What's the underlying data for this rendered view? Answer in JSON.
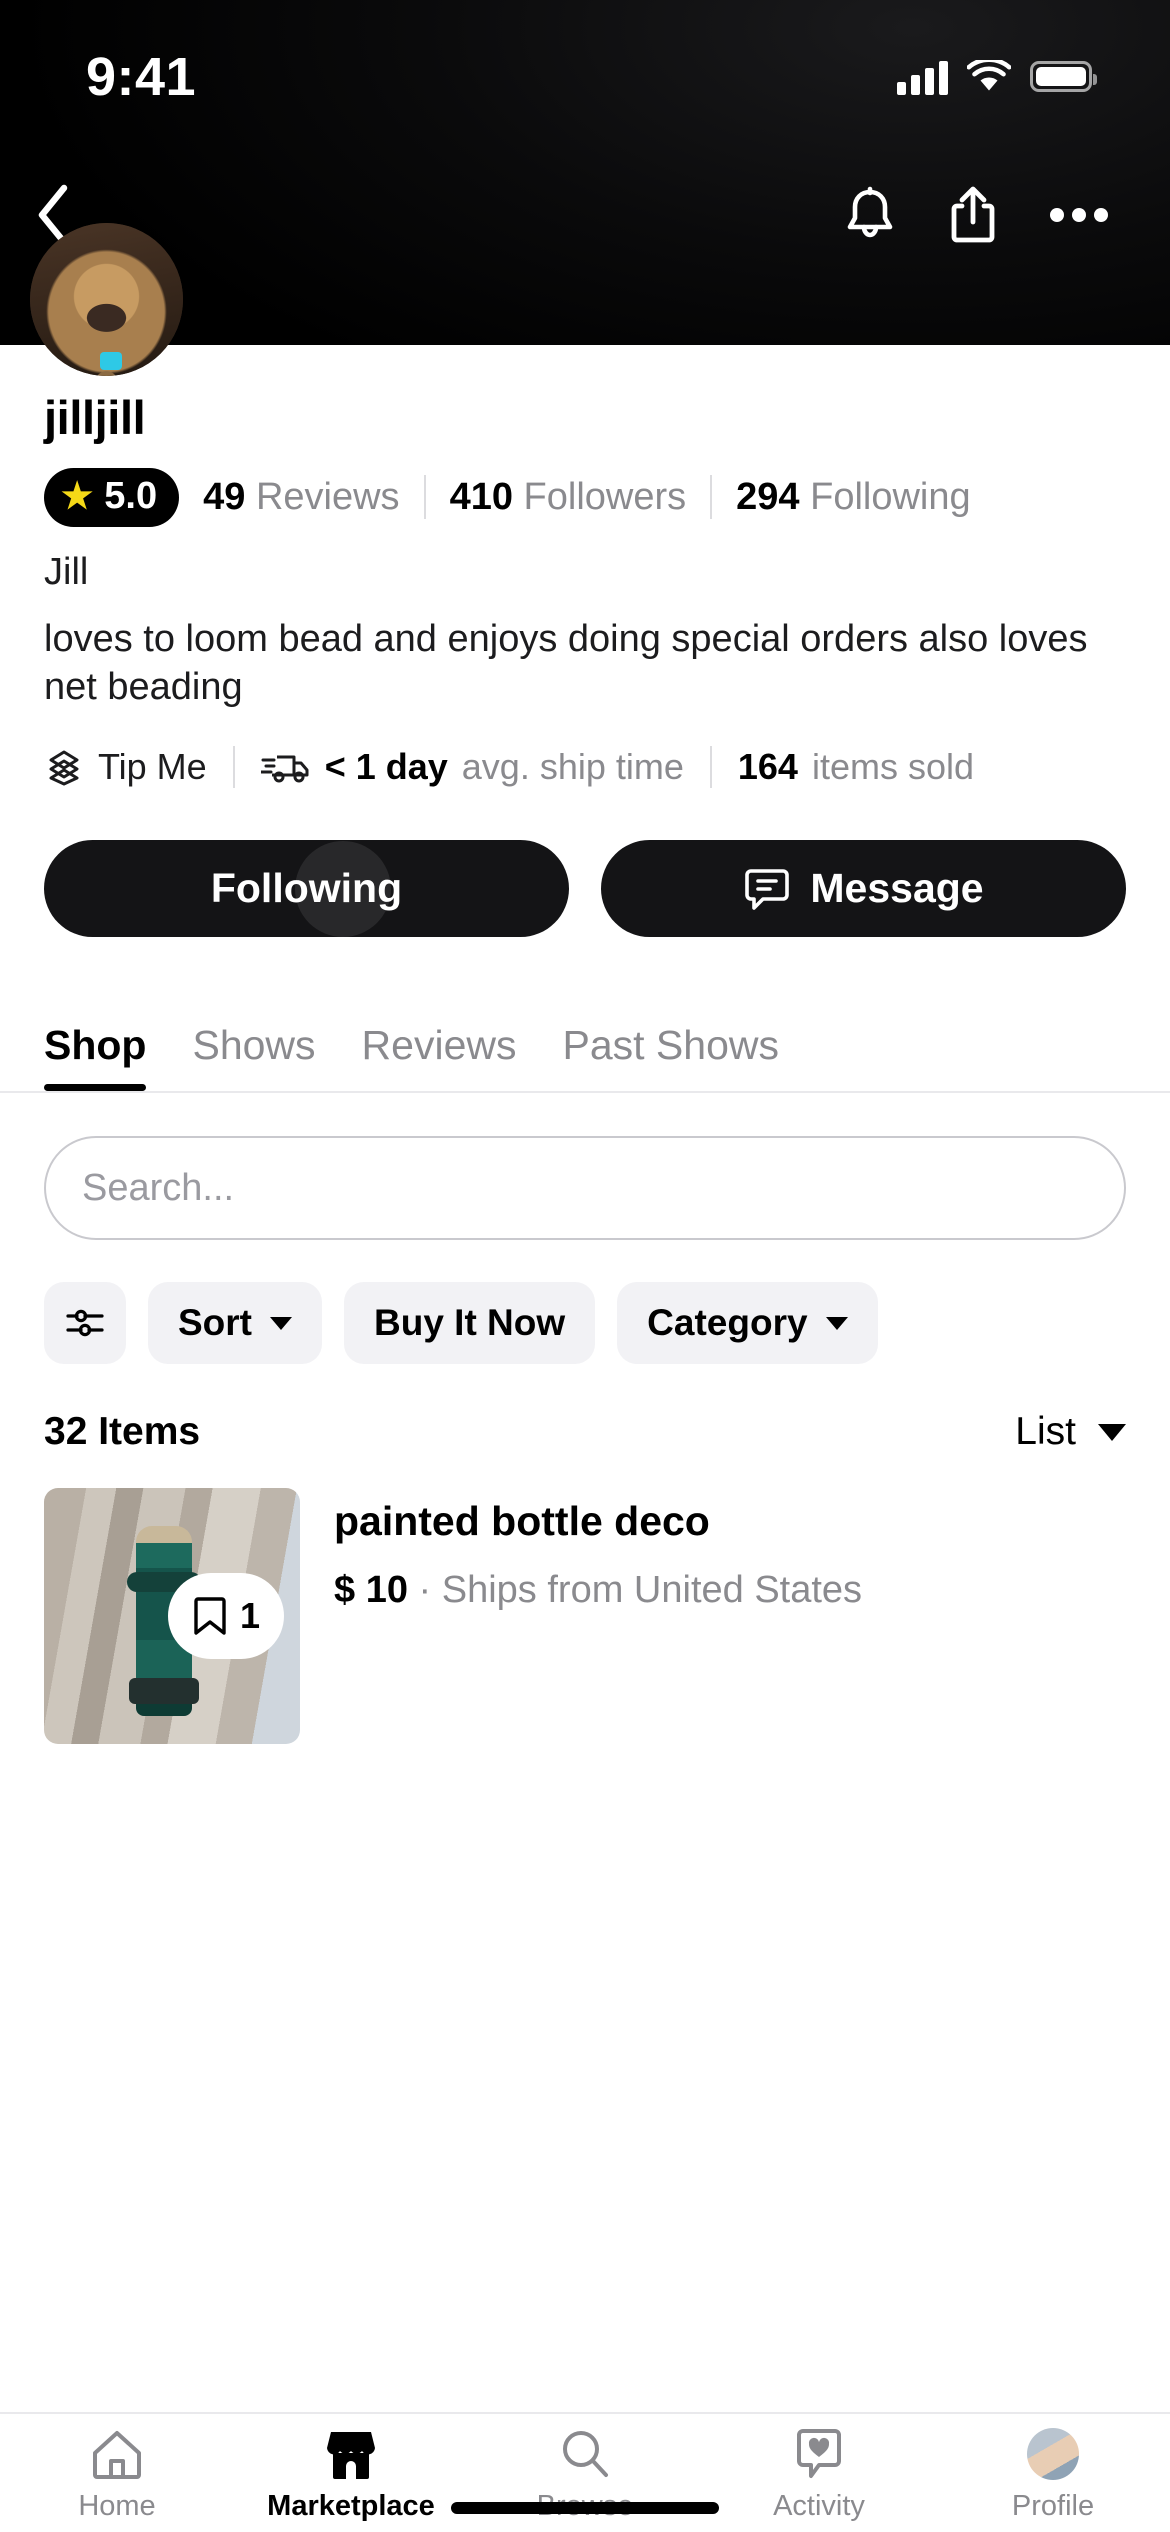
{
  "status_bar": {
    "time": "9:41",
    "signal_icon": "cellular-bars-icon",
    "wifi_icon": "wifi-icon",
    "battery_icon": "battery-full-icon"
  },
  "navbar": {
    "back_icon": "back-chevron-icon",
    "notifications_icon": "bell-icon",
    "share_icon": "share-icon",
    "more_icon": "more-dots-icon"
  },
  "profile": {
    "avatar_icon": "profile-avatar-dog-photo",
    "username": "jilljill",
    "rating": "5.0",
    "rating_star_icon": "star-icon",
    "rating_star_color": "#F5D917",
    "reviews_count": "49",
    "reviews_label": "Reviews",
    "followers_count": "410",
    "followers_label": "Followers",
    "following_count": "294",
    "following_label": "Following",
    "display_name": "Jill",
    "bio": "loves to loom bead and enjoys doing special orders also loves net beading",
    "tip_icon": "tip-cash-icon",
    "tip_label": "Tip Me",
    "ship_icon": "shipping-truck-icon",
    "ship_time": "< 1 day",
    "ship_label": "avg. ship time",
    "items_sold_count": "164",
    "items_sold_label": "items sold",
    "follow_button": "Following",
    "message_button": "Message",
    "message_icon": "chat-bubble-icon"
  },
  "tabs": [
    {
      "label": "Shop",
      "active": true
    },
    {
      "label": "Shows",
      "active": false
    },
    {
      "label": "Reviews",
      "active": false
    },
    {
      "label": "Past Shows",
      "active": false
    }
  ],
  "search": {
    "placeholder": "Search...",
    "value": ""
  },
  "filters": {
    "filter_icon": "sliders-filter-icon",
    "chips": [
      {
        "label": "Sort",
        "has_chevron": true
      },
      {
        "label": "Buy It Now",
        "has_chevron": false
      },
      {
        "label": "Category",
        "has_chevron": true
      }
    ]
  },
  "listing_header": {
    "items_count": "32 Items",
    "view_mode": "List",
    "view_chevron_icon": "chevron-down-icon"
  },
  "products": [
    {
      "title": "painted bottle deco",
      "price": "$ 10",
      "separator": "·",
      "shipping": "Ships from United States",
      "save_icon": "bookmark-icon",
      "save_count": "1",
      "image_icon": "painted-green-bottle-photo"
    }
  ],
  "bottom_nav": [
    {
      "label": "Home",
      "icon": "home-icon",
      "active": false
    },
    {
      "label": "Marketplace",
      "icon": "storefront-icon",
      "active": true
    },
    {
      "label": "Browse",
      "icon": "search-magnifier-icon",
      "active": false
    },
    {
      "label": "Activity",
      "icon": "heart-bubble-icon",
      "active": false
    },
    {
      "label": "Profile",
      "icon": "profile-avatar-icon",
      "active": false
    }
  ],
  "colors": {
    "accent_dark": "#141416",
    "muted_text": "#8A8A8E",
    "chip_bg": "#F2F2F5"
  }
}
